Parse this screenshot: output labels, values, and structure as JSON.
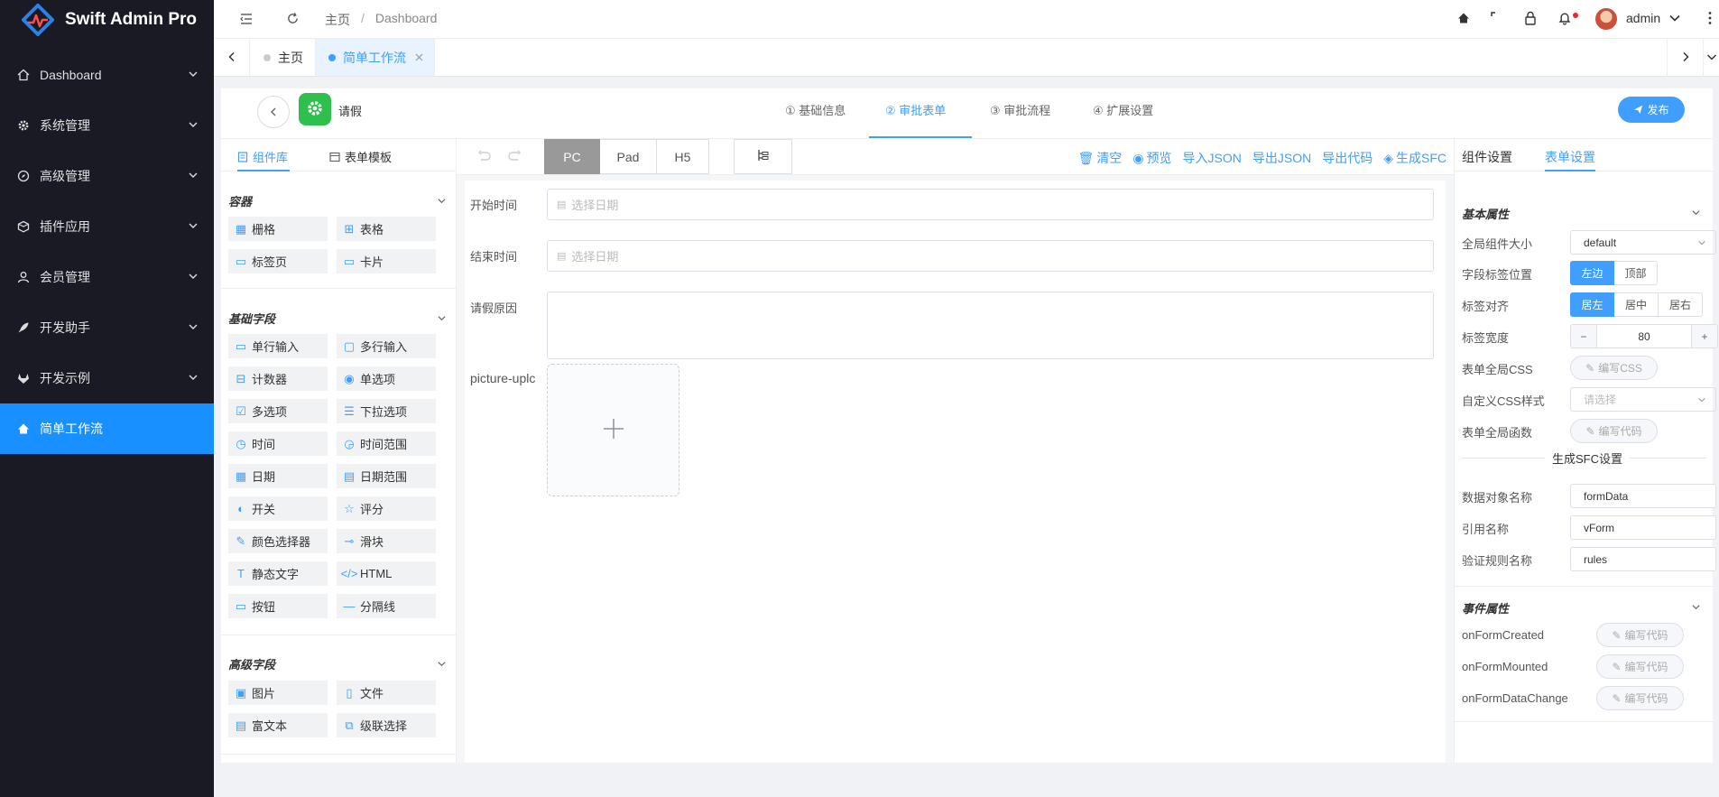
{
  "app": {
    "name": "Swift Admin Pro"
  },
  "sidebar": {
    "items": [
      {
        "label": "Dashboard",
        "icon": "home-icon"
      },
      {
        "label": "系统管理",
        "icon": "gear-icon"
      },
      {
        "label": "高级管理",
        "icon": "compass-icon"
      },
      {
        "label": "插件应用",
        "icon": "box-icon"
      },
      {
        "label": "会员管理",
        "icon": "user-icon"
      },
      {
        "label": "开发助手",
        "icon": "rocket-icon"
      },
      {
        "label": "开发示例",
        "icon": "gitlab-icon"
      },
      {
        "label": "简单工作流",
        "icon": "home-icon",
        "active": true
      }
    ]
  },
  "topbar": {
    "breadcrumb": [
      "主页",
      "Dashboard"
    ],
    "separator": "/",
    "user": "admin",
    "notification_dot_color": "#f5222d"
  },
  "tabs": [
    {
      "label": "主页",
      "active": false
    },
    {
      "label": "简单工作流",
      "active": true,
      "closable": true
    }
  ],
  "workflow": {
    "title": "请假",
    "steps": [
      {
        "label": "① 基础信息",
        "active": false
      },
      {
        "label": "② 审批表单",
        "active": true
      },
      {
        "label": "③ 审批流程",
        "active": false
      },
      {
        "label": "④ 扩展设置",
        "active": false
      }
    ],
    "publish_label": "发布"
  },
  "left_panel": {
    "tabs": [
      "组件库",
      "表单模板"
    ],
    "sections": [
      {
        "title": "容器",
        "items": [
          "栅格",
          "表格",
          "标签页",
          "卡片"
        ]
      },
      {
        "title": "基础字段",
        "items": [
          "单行输入",
          "多行输入",
          "计数器",
          "单选项",
          "多选项",
          "下拉选项",
          "时间",
          "时间范围",
          "日期",
          "日期范围",
          "开关",
          "评分",
          "颜色选择器",
          "滑块",
          "静态文字",
          "HTML",
          "按钮",
          "分隔线"
        ]
      },
      {
        "title": "高级字段",
        "items": [
          "图片",
          "文件",
          "富文本",
          "级联选择"
        ]
      }
    ]
  },
  "toolbar": {
    "devices": [
      "PC",
      "Pad",
      "H5"
    ],
    "active_device": "PC",
    "actions": [
      "清空",
      "预览",
      "导入JSON",
      "导出JSON",
      "导出代码",
      "生成SFC"
    ]
  },
  "form": {
    "fields": [
      {
        "label": "开始时间",
        "placeholder": "选择日期"
      },
      {
        "label": "结束时间",
        "placeholder": "选择日期"
      },
      {
        "label": "请假原因",
        "placeholder": ""
      },
      {
        "label": "picture-uplc"
      }
    ]
  },
  "right_panel": {
    "tabs": [
      "组件设置",
      "表单设置"
    ],
    "basic_title": "基本属性",
    "rows": {
      "size_label": "全局组件大小",
      "size_value": "default",
      "label_pos_label": "字段标签位置",
      "label_pos_options": [
        "左边",
        "顶部"
      ],
      "align_label": "标签对齐",
      "align_options": [
        "居左",
        "居中",
        "居右"
      ],
      "width_label": "标签宽度",
      "width_value": "80",
      "minus": "−",
      "plus": "+",
      "css_label": "表单全局CSS",
      "css_btn": "编写CSS",
      "custom_css_label": "自定义CSS样式",
      "custom_css_placeholder": "请选择",
      "func_label": "表单全局函数",
      "func_btn": "编写代码"
    },
    "sfc_title": "生成SFC设置",
    "sfc": {
      "data_label": "数据对象名称",
      "data_value": "formData",
      "ref_label": "引用名称",
      "ref_value": "vForm",
      "rules_label": "验证规则名称",
      "rules_value": "rules"
    },
    "event_title": "事件属性",
    "events": [
      {
        "label": "onFormCreated",
        "btn": "编写代码"
      },
      {
        "label": "onFormMounted",
        "btn": "编写代码"
      },
      {
        "label": "onFormDataChange",
        "btn": "编写代码"
      }
    ]
  }
}
